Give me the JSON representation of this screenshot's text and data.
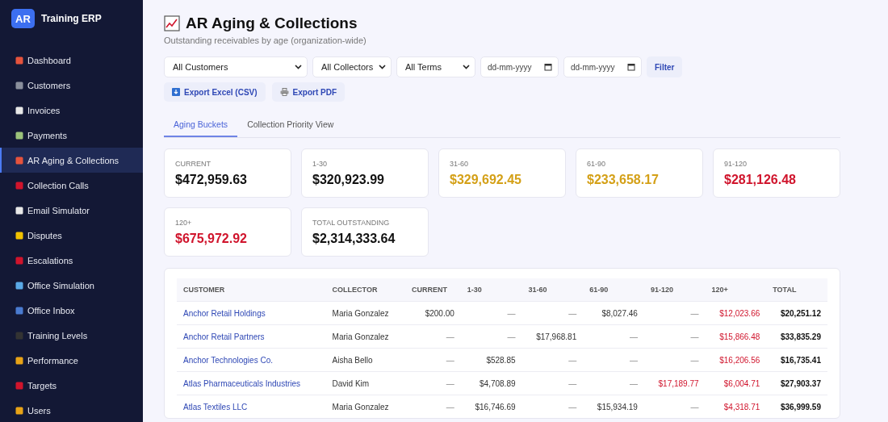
{
  "sidebar": {
    "logo": "AR",
    "app_name": "Training ERP",
    "items": [
      {
        "label": "Dashboard",
        "selected": false
      },
      {
        "label": "Customers",
        "selected": false
      },
      {
        "label": "Invoices",
        "selected": false
      },
      {
        "label": "Payments",
        "selected": false
      },
      {
        "label": "AR Aging & Collections",
        "selected": true
      },
      {
        "label": "Collection Calls",
        "selected": false
      },
      {
        "label": "Email Simulator",
        "selected": false
      },
      {
        "label": "Disputes",
        "selected": false
      },
      {
        "label": "Escalations",
        "selected": false
      },
      {
        "label": "Office Simulation",
        "selected": false
      },
      {
        "label": "Office Inbox",
        "selected": false
      },
      {
        "label": "Training Levels",
        "selected": false
      },
      {
        "label": "Performance",
        "selected": false
      },
      {
        "label": "Targets",
        "selected": false
      },
      {
        "label": "Users",
        "selected": false
      }
    ]
  },
  "header": {
    "title": "AR Aging & Collections",
    "subtitle": "Outstanding receivables by age (organization-wide)"
  },
  "filters": {
    "customer": "All Customers",
    "collector": "All Collectors",
    "terms": "All Terms",
    "date_from": {
      "placeholder": "dd-mm-yyyy"
    },
    "date_to": {
      "placeholder": "dd-mm-yyyy"
    },
    "filter_button": "Filter"
  },
  "exports": [
    "Export Excel (CSV)",
    "Export PDF"
  ],
  "tabs": [
    {
      "label": "Aging Buckets",
      "selected": true
    },
    {
      "label": "Collection Priority View",
      "selected": false
    }
  ],
  "cards": [
    {
      "label": "CURRENT",
      "value": "$472,959.63",
      "color": "#111111"
    },
    {
      "label": "1-30",
      "value": "$320,923.99",
      "color": "#111111"
    },
    {
      "label": "31-60",
      "value": "$329,692.45",
      "color": "#d4a017"
    },
    {
      "label": "61-90",
      "value": "$233,658.17",
      "color": "#d4a017"
    },
    {
      "label": "91-120",
      "value": "$281,126.48",
      "color": "#d0142c"
    },
    {
      "label": "120+",
      "value": "$675,972.92",
      "color": "#d0142c"
    },
    {
      "label": "TOTAL OUTSTANDING",
      "value": "$2,314,333.64",
      "color": "#111111"
    }
  ],
  "table": {
    "columns": [
      {
        "label": "CUSTOMER",
        "kind": "link"
      },
      {
        "label": "COLLECTOR",
        "kind": "text"
      },
      {
        "label": "CURRENT",
        "kind": "amount"
      },
      {
        "label": "1-30",
        "kind": "amount"
      },
      {
        "label": "31-60",
        "kind": "amount"
      },
      {
        "label": "61-90",
        "kind": "amount"
      },
      {
        "label": "91-120",
        "kind": "overdue"
      },
      {
        "label": "120+",
        "kind": "overdue"
      },
      {
        "label": "TOTAL",
        "kind": "total"
      }
    ],
    "rows": [
      [
        "Anchor Retail Holdings",
        "Maria Gonzalez",
        "$200.00",
        "—",
        "—",
        "$8,027.46",
        "—",
        "$12,023.66",
        "$20,251.12"
      ],
      [
        "Anchor Retail Partners",
        "Maria Gonzalez",
        "—",
        "—",
        "$17,968.81",
        "—",
        "—",
        "$15,866.48",
        "$33,835.29"
      ],
      [
        "Anchor Technologies Co.",
        "Aisha Bello",
        "—",
        "$528.85",
        "—",
        "—",
        "—",
        "$16,206.56",
        "$16,735.41"
      ],
      [
        "Atlas Pharmaceuticals Industries",
        "David Kim",
        "—",
        "$4,708.89",
        "—",
        "—",
        "$17,189.77",
        "$6,004.71",
        "$27,903.37"
      ],
      [
        "Atlas Textiles LLC",
        "Maria Gonzalez",
        "—",
        "$16,746.69",
        "—",
        "$15,934.19",
        "—",
        "$4,318.71",
        "$36,999.59"
      ]
    ]
  }
}
